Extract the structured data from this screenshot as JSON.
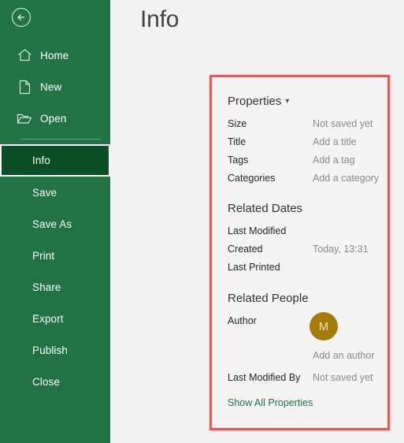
{
  "colors": {
    "sidebar_green": "#217346",
    "sidebar_selected_green": "#0c4f27",
    "highlight_red": "#f4534d",
    "panel_bg": "#f4f4f4",
    "main_bg": "#f2f2f2",
    "avatar_gold": "#a67c08",
    "link_green": "#217346"
  },
  "sidebar": {
    "back_icon": "back-arrow-circle-icon",
    "items": [
      {
        "label": "Home",
        "icon": "home-icon",
        "selected": false,
        "has_icon": true
      },
      {
        "label": "New",
        "icon": "new-file-icon",
        "selected": false,
        "has_icon": true
      },
      {
        "label": "Open",
        "icon": "open-folder-icon",
        "selected": false,
        "has_icon": true
      },
      {
        "label": "Info",
        "icon": "",
        "selected": true,
        "has_icon": false
      },
      {
        "label": "Save",
        "icon": "",
        "selected": false,
        "has_icon": false
      },
      {
        "label": "Save As",
        "icon": "",
        "selected": false,
        "has_icon": false
      },
      {
        "label": "Print",
        "icon": "",
        "selected": false,
        "has_icon": false
      },
      {
        "label": "Share",
        "icon": "",
        "selected": false,
        "has_icon": false
      },
      {
        "label": "Export",
        "icon": "",
        "selected": false,
        "has_icon": false
      },
      {
        "label": "Publish",
        "icon": "",
        "selected": false,
        "has_icon": false
      },
      {
        "label": "Close",
        "icon": "",
        "selected": false,
        "has_icon": false
      }
    ]
  },
  "main": {
    "page_title": "Info"
  },
  "properties_panel": {
    "header": {
      "title": "Properties",
      "chevron": "chevron-down-icon"
    },
    "properties": [
      {
        "label": "Size",
        "value": "Not saved yet"
      },
      {
        "label": "Title",
        "value": "Add a title"
      },
      {
        "label": "Tags",
        "value": "Add a tag"
      },
      {
        "label": "Categories",
        "value": "Add a category"
      }
    ],
    "related_dates": {
      "heading": "Related Dates",
      "rows": [
        {
          "label": "Last Modified",
          "value": ""
        },
        {
          "label": "Created",
          "value": "Today, 13:31"
        },
        {
          "label": "Last Printed",
          "value": ""
        }
      ]
    },
    "related_people": {
      "heading": "Related People",
      "author_label": "Author",
      "avatar_initial": "M",
      "add_author_text": "Add an author",
      "last_modified_by_label": "Last Modified By",
      "last_modified_by_value": "Not saved yet"
    },
    "show_all_properties": "Show All Properties"
  }
}
